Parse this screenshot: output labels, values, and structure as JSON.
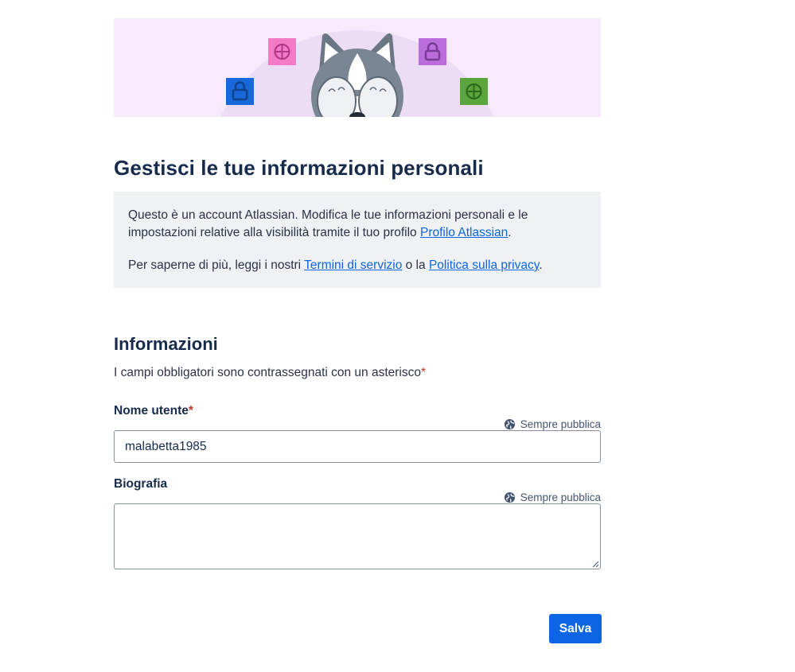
{
  "hero": {
    "illustration": "husky-covering-eyes",
    "icons": [
      "lock-icon",
      "dribbble-icon",
      "lock-icon",
      "dribbble-icon"
    ]
  },
  "page": {
    "title": "Gestisci le tue informazioni personali"
  },
  "notice": {
    "line1_text": "Questo è un account Atlassian. Modifica le tue informazioni personali e le impostazioni relative alla visibilità tramite il tuo profilo ",
    "line1_link": "Profilo Atlassian",
    "line1_end": ".",
    "line2_text": "Per saperne di più, leggi i nostri ",
    "terms_link": "Termini di servizio",
    "line2_mid": " o la ",
    "privacy_link": "Politica sulla privacy",
    "line2_end": "."
  },
  "info": {
    "title": "Informazioni",
    "required_note": "I campi obbligatori sono contrassegnati con un asterisco",
    "asterisk": "*"
  },
  "fields": {
    "username": {
      "label": "Nome utente",
      "required": "*",
      "visibility": "Sempre pubblica",
      "value": "malabetta1985"
    },
    "bio": {
      "label": "Biografia",
      "visibility": "Sempre pubblica",
      "value": ""
    }
  },
  "actions": {
    "save": "Salva"
  },
  "colors": {
    "accent": "#0c66e4",
    "required": "#c9372c",
    "hero_background": "#f6eafc"
  }
}
